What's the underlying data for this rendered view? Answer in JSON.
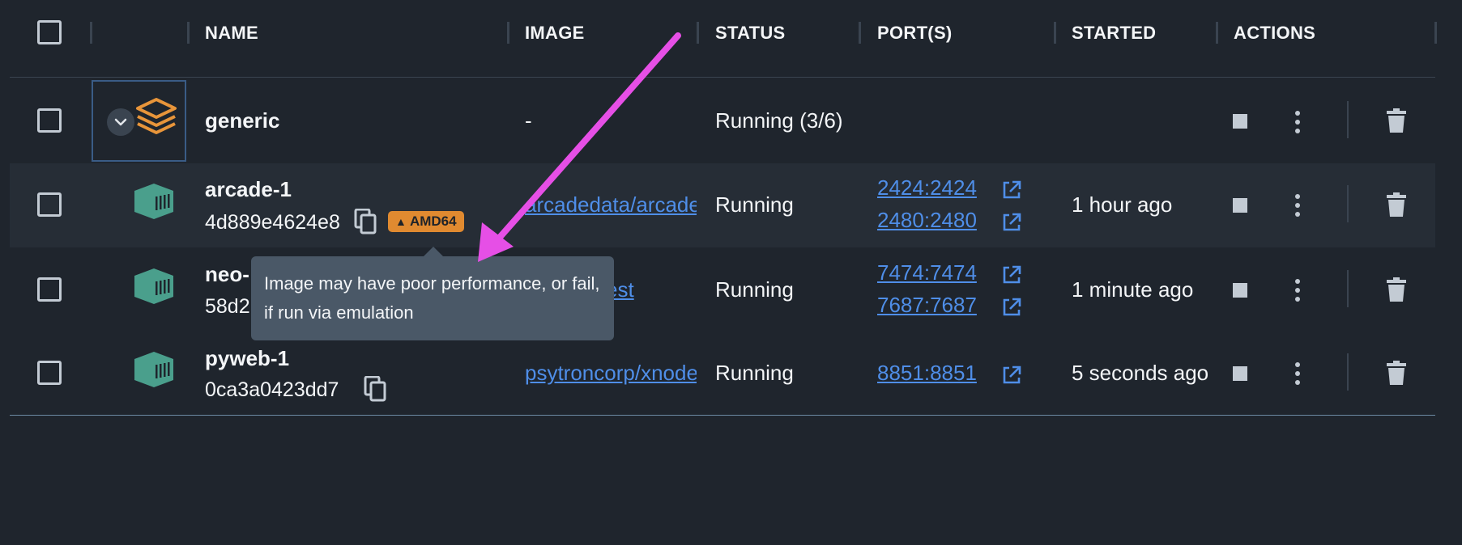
{
  "columns": {
    "name": "NAME",
    "image": "IMAGE",
    "status": "STATUS",
    "ports": "PORT(S)",
    "started": "STARTED",
    "actions": "ACTIONS"
  },
  "group": {
    "name": "generic",
    "image": "-",
    "status": "Running (3/6)",
    "icon": "stack-icon"
  },
  "containers": [
    {
      "name": "arcade-1",
      "id": "4d889e4624e8",
      "badge": "AMD64",
      "image": "arcadedata/arcadedb",
      "status": "Running",
      "ports": [
        "2424:2424",
        "2480:2480"
      ],
      "started": "1 hour ago"
    },
    {
      "name": "neo-",
      "id": "58d2",
      "image": "est",
      "status": "Running",
      "ports": [
        "7474:7474",
        "7687:7687"
      ],
      "started": "1 minute ago"
    },
    {
      "name": "pyweb-1",
      "id": "0ca3a0423dd7",
      "image": "psytroncorp/xnode",
      "status": "Running",
      "ports": [
        "8851:8851"
      ],
      "started": "5 seconds ago"
    }
  ],
  "tooltip": {
    "text": "Image may have poor performance, or fail, if run via emulation"
  },
  "colors": {
    "background": "#1f252d",
    "row_alt": "#262d36",
    "link": "#4f8ee8",
    "badge": "#e08a30",
    "group_icon": "#e8953a",
    "container_icon": "#4a9f8c",
    "annotation_arrow": "#e64fe6"
  }
}
